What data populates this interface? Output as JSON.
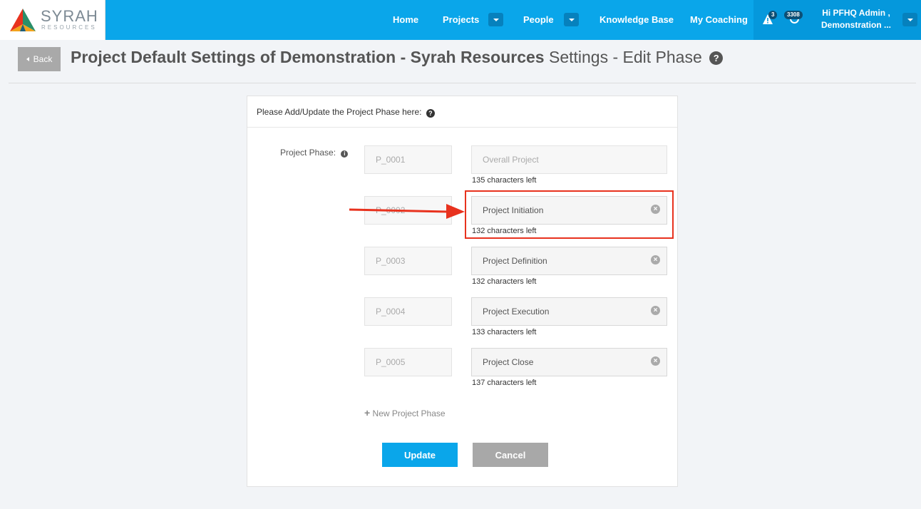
{
  "brand": {
    "name": "SYRAH",
    "tagline": "RESOURCES"
  },
  "nav": {
    "home": "Home",
    "projects": "Projects",
    "people": "People",
    "knowledge_base": "Knowledge Base",
    "my_coaching": "My Coaching"
  },
  "header_icons": {
    "alerts_count": "3",
    "messages_count": "3308"
  },
  "user": {
    "greeting_line1": "Hi PFHQ Admin ,",
    "greeting_line2": "Demonstration ..."
  },
  "page": {
    "back_label": "Back",
    "title_bold": "Project Default Settings of Demonstration - Syrah Resources",
    "title_rest": " Settings - Edit Phase",
    "help_glyph": "?"
  },
  "panel": {
    "heading": "Please Add/Update the Project Phase here:",
    "field_label": "Project Phase:",
    "phases": [
      {
        "code": "P_0001",
        "name": "Overall Project",
        "chars_left": "135 characters left"
      },
      {
        "code": "P_0002",
        "name": "Project Initiation",
        "chars_left": "132 characters left"
      },
      {
        "code": "P_0003",
        "name": "Project Definition",
        "chars_left": "132 characters left"
      },
      {
        "code": "P_0004",
        "name": "Project Execution",
        "chars_left": "133 characters left"
      },
      {
        "code": "P_0005",
        "name": "Project Close",
        "chars_left": "137 characters left"
      }
    ],
    "new_phase_label": "New Project Phase",
    "update_label": "Update",
    "cancel_label": "Cancel"
  },
  "colors": {
    "primary": "#0aa6ea",
    "highlight": "#e8321e",
    "cancel": "#a8a8a8"
  }
}
